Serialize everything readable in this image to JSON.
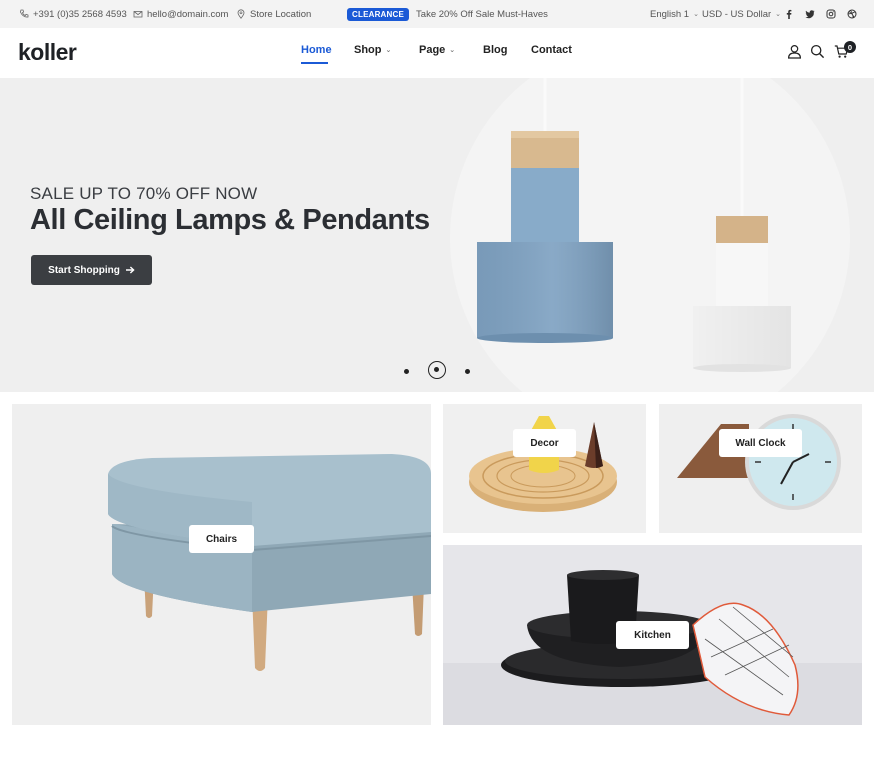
{
  "topbar": {
    "phone": "+391 (0)35 2568 4593",
    "email": "hello@domain.com",
    "store": "Store Location",
    "badge": "CLEARANCE",
    "promo": "Take 20% Off Sale Must-Haves",
    "language": "English 1",
    "currency": "USD - US Dollar",
    "socials": [
      "facebook-icon",
      "twitter-icon",
      "instagram-icon",
      "dribbble-icon"
    ]
  },
  "header": {
    "logo": "koller",
    "nav": [
      {
        "label": "Home",
        "active": true
      },
      {
        "label": "Shop",
        "dropdown": true
      },
      {
        "label": "Page",
        "dropdown": true
      },
      {
        "label": "Blog"
      },
      {
        "label": "Contact"
      }
    ],
    "cart_count": "0",
    "icons": [
      "user-icon",
      "search-icon",
      "cart-icon"
    ]
  },
  "hero": {
    "subtitle": "SALE UP TO 70% OFF NOW",
    "title": "All Ceiling Lamps & Pendants",
    "button": "Start Shopping",
    "slides": 3,
    "active_slide": 2
  },
  "categories": [
    {
      "label": "Chairs"
    },
    {
      "label": "Decor"
    },
    {
      "label": "Wall Clock"
    },
    {
      "label": "Kitchen"
    }
  ],
  "colors": {
    "accent": "#1b5ad6",
    "dark": "#1e2125",
    "hero_bg": "#efefef"
  }
}
